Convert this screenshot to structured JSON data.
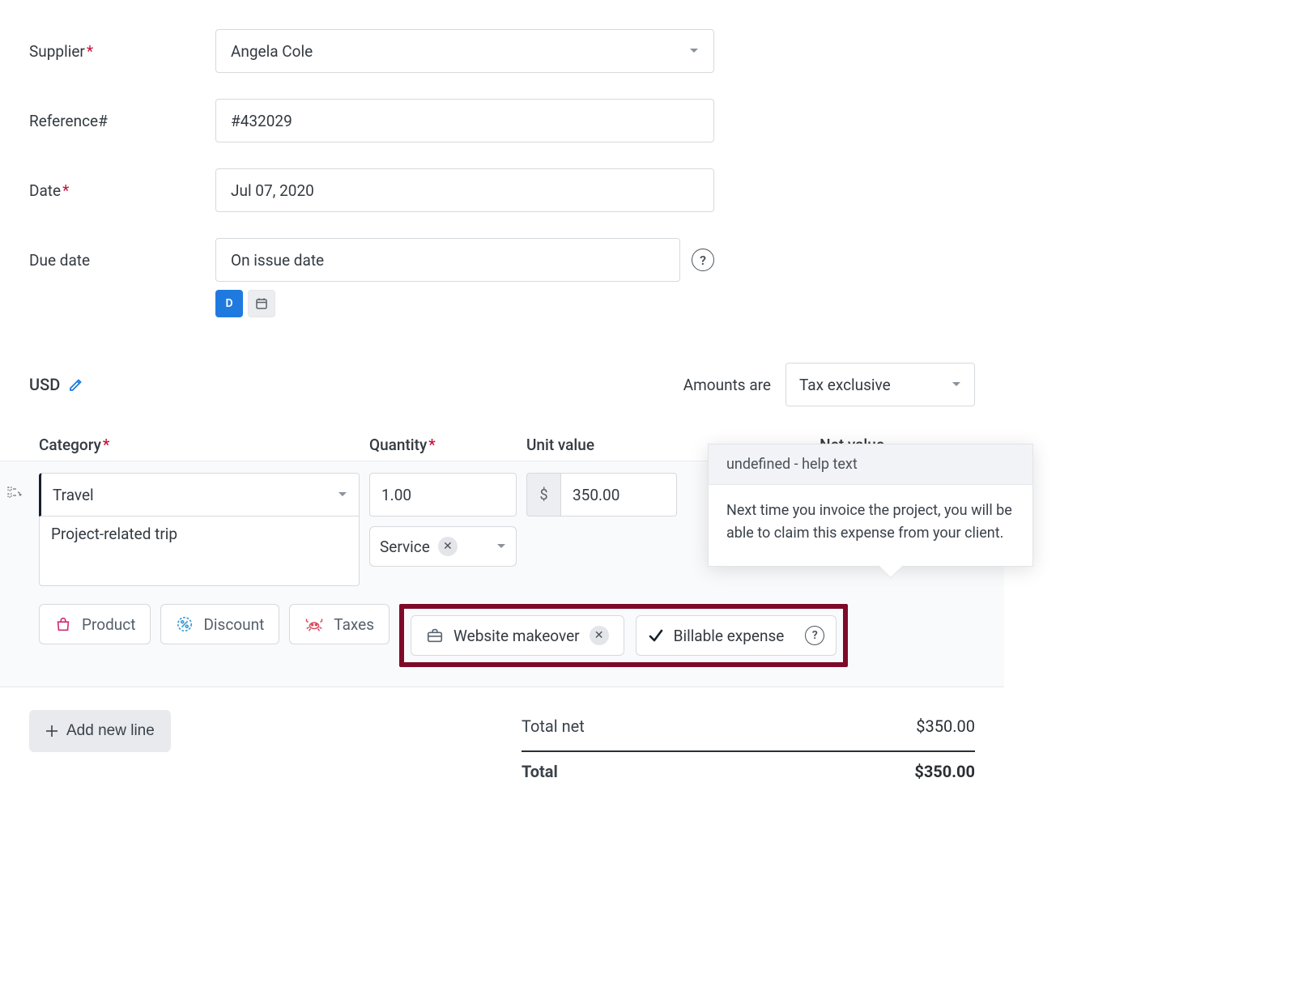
{
  "form": {
    "supplier_label": "Supplier",
    "supplier_value": "Angela Cole",
    "reference_label": "Reference#",
    "reference_value": "#432029",
    "date_label": "Date",
    "date_value": "Jul 07, 2020",
    "due_label": "Due date",
    "due_value": "On issue date",
    "mode_d": "D"
  },
  "currency": {
    "code": "USD"
  },
  "amounts": {
    "label": "Amounts are",
    "mode": "Tax exclusive"
  },
  "headers": {
    "category": "Category",
    "quantity": "Quantity",
    "unit": "Unit value",
    "net": "Net value"
  },
  "line": {
    "category": "Travel",
    "description": "Project-related trip",
    "quantity": "1.00",
    "unit_symbol": "$",
    "unit_value": "350.00",
    "service_label": "Service"
  },
  "tags": {
    "product": "Product",
    "discount": "Discount",
    "taxes": "Taxes",
    "project": "Website makeover",
    "billable": "Billable expense"
  },
  "tooltip": {
    "title": "undefined - help text",
    "body": "Next time you invoice the project, you will be able to claim this expense from your client."
  },
  "footer": {
    "add_line": "Add new line"
  },
  "totals": {
    "net_label": "Total net",
    "net_value": "$350.00",
    "total_label": "Total",
    "total_value": "$350.00"
  }
}
